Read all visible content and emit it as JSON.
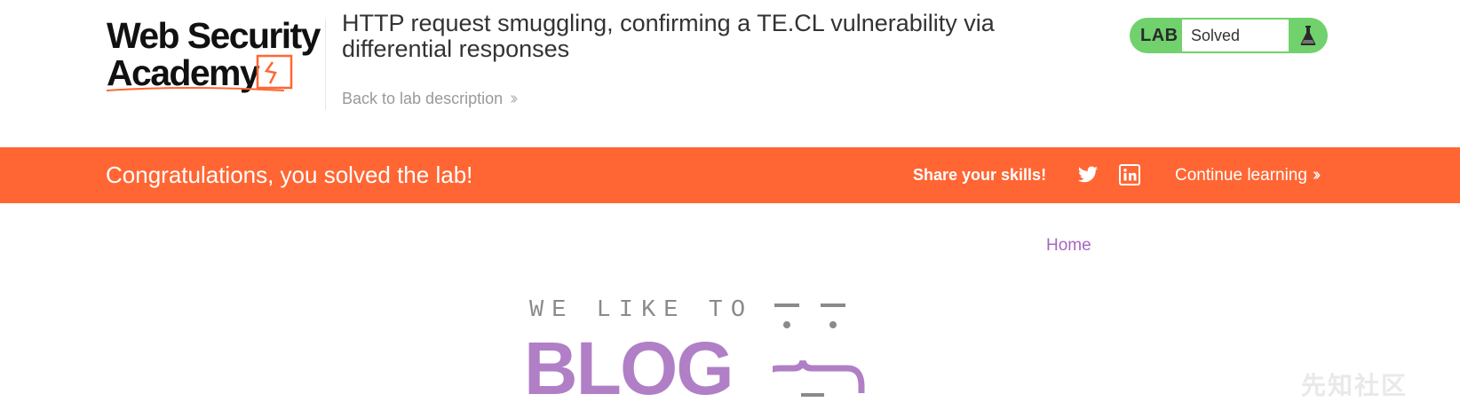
{
  "header": {
    "logo": {
      "line1": "Web Security",
      "line2": "Academy"
    },
    "lab_title": "HTTP request smuggling, confirming a TE.CL vulnerability via differential responses",
    "back_link": "Back to lab description",
    "status_widget": {
      "tag": "LAB",
      "status": "Solved",
      "icon": "flask-icon"
    }
  },
  "banner": {
    "message": "Congratulations, you solved the lab!",
    "share_label": "Share your skills!",
    "share_icons": [
      "twitter-icon",
      "linkedin-icon"
    ],
    "continue_label": "Continue learning"
  },
  "nav": {
    "home": "Home"
  },
  "blog_header": {
    "tagline": "WE LIKE TO",
    "title": "BLOG"
  },
  "watermark": "先知社区",
  "colors": {
    "banner_bg": "#ff6633",
    "status_green": "#70d16d",
    "accent_purple": "#b07fc6",
    "link_purple": "#a867bf",
    "logo_orange": "#ff6633"
  }
}
